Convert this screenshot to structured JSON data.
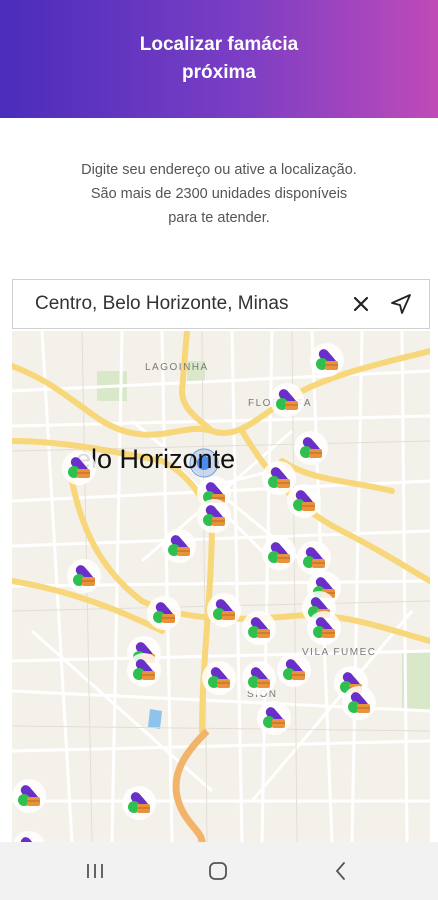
{
  "header": {
    "title": "Localizar famácia próxima"
  },
  "intro": {
    "line1": "Digite seu endereço ou ative a localização.",
    "line2": "São mais de 2300 unidades disponíveis",
    "line3": "para te atender."
  },
  "search": {
    "value": "Centro, Belo Horizonte, Minas",
    "clear_icon": "close-icon",
    "locate_icon": "navigation-arrow-icon"
  },
  "map": {
    "city_label": "elo Horizonte",
    "neighborhoods": [
      "LAGOINHA",
      "FLORESTA",
      "VILA FUMEC",
      "SION"
    ],
    "pin_icon": "pharmacy-pill-icon",
    "pin_count": 29
  },
  "navbar": {
    "recent_icon": "recent-apps-icon",
    "home_icon": "home-icon",
    "back_icon": "back-icon"
  },
  "colors": {
    "header_start": "#4a2dbb",
    "header_end": "#c04ab8",
    "pill_purple": "#6a2ec9",
    "pill_green": "#2ebf4f",
    "box_orange": "#e8923a",
    "road_yellow": "#f7d77a"
  }
}
